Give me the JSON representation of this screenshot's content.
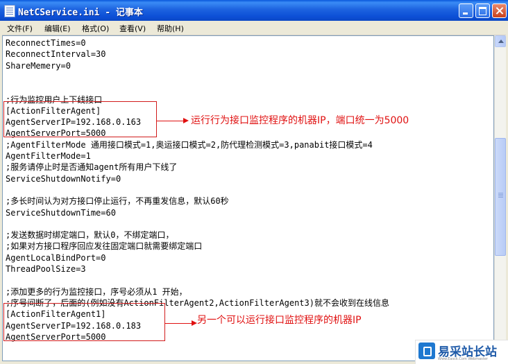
{
  "window": {
    "title": "NetCService.ini - 记事本"
  },
  "menu": [
    {
      "label": "文件(F)"
    },
    {
      "label": "编辑(E)"
    },
    {
      "label": "格式(O)"
    },
    {
      "label": "查看(V)"
    },
    {
      "label": "帮助(H)"
    }
  ],
  "editor": {
    "lines": [
      "ReconnectTimes=0",
      "ReconnectInterval=30",
      "ShareMemery=0",
      "",
      "",
      ";行为监控用户上下线接口",
      "[ActionFilterAgent]",
      "AgentServerIP=192.168.0.163",
      "AgentServerPort=5000",
      ";AgentFilterMode 通用接口模式=1,奥运接口模式=2,防代理检测模式=3,panabit接口模式=4",
      "AgentFilterMode=1",
      ";服务请停止时是否通知agent所有用户下线了",
      "ServiceShutdownNotify=0",
      "",
      ";多长时间认为对方接口停止运行，不再重发信息，默认60秒",
      "ServiceShutdownTime=60",
      "",
      ";发送数据时绑定端口，默认0，不绑定端口，",
      ";如果对方接口程序回应发往固定端口就需要绑定端口",
      "AgentLocalBindPort=0",
      "ThreadPoolSize=3",
      "",
      ";添加更多的行为监控接口，序号必须从1 开始，",
      ";序号间断了，后面的(例如没有ActionFilterAgent2,ActionFilterAgent3)就不会收到在线信息",
      "[ActionFilterAgent1]",
      "AgentServerIP=192.168.0.183",
      "AgentServerPort=5000"
    ]
  },
  "annotations": [
    {
      "text": "运行行为接口监控程序的机器IP，端口统一为5000"
    },
    {
      "text": "另一个可以运行接口监控程序的机器IP"
    }
  ],
  "watermark": {
    "title": "易采站长站",
    "subtitle": "Www.Easck.Com Webmaster"
  },
  "colors": {
    "annotation": "#e01010",
    "titlebar": "#0c4fd6"
  }
}
